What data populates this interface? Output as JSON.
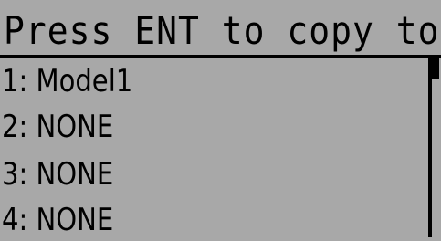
{
  "header": {
    "title": "Press ENT to copy to"
  },
  "menu": {
    "items": [
      {
        "label": "1: Model1"
      },
      {
        "label": "2: NONE"
      },
      {
        "label": "3: NONE"
      },
      {
        "label": "4: NONE"
      }
    ]
  },
  "colors": {
    "background": "#a8a8a8",
    "foreground": "#000000"
  }
}
